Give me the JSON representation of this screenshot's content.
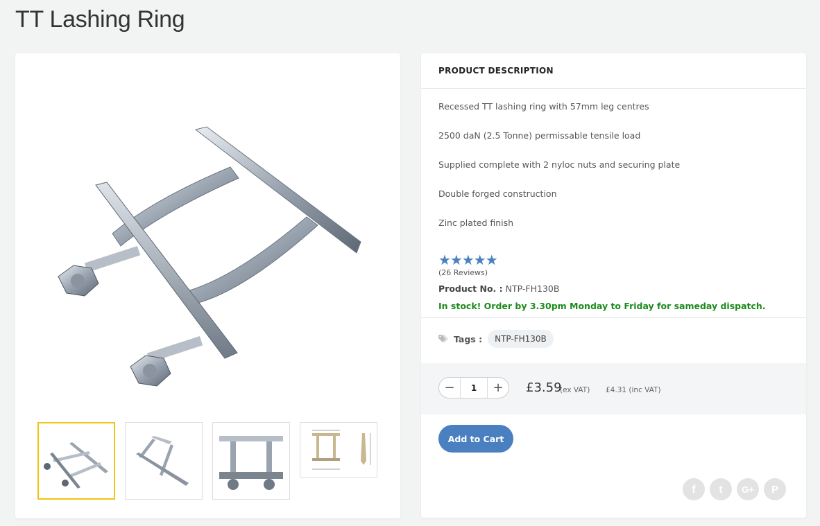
{
  "page": {
    "title": "TT Lashing Ring"
  },
  "description": {
    "header": "PRODUCT DESCRIPTION",
    "lines": [
      "Recessed TT lashing ring with 57mm leg centres",
      "2500 daN (2.5 Tonne) permissable tensile load",
      "Supplied complete with 2 nyloc nuts and securing plate",
      "Double forged construction",
      "Zinc plated finish"
    ]
  },
  "rating": {
    "stars": "★★★★★",
    "value": 5,
    "reviews": "(26 Reviews)"
  },
  "product": {
    "number_label": "Product No. :",
    "number": "NTP-FH130B",
    "stock": "In stock! Order by 3.30pm Monday to Friday for sameday dispatch."
  },
  "tags": {
    "label": "Tags :",
    "items": [
      "NTP-FH130B"
    ],
    "icon": "tag-icon"
  },
  "purchase": {
    "quantity": "1",
    "minus": "−",
    "plus": "+",
    "price": "£3.59",
    "ex_vat": "(ex VAT)",
    "inc_vat": "£4.31 (inc VAT)",
    "add_to_cart": "Add to Cart"
  },
  "social": [
    {
      "icon": "facebook-icon",
      "glyph": "f"
    },
    {
      "icon": "twitter-icon",
      "glyph": "t"
    },
    {
      "icon": "google-plus-icon",
      "glyph": "G+"
    },
    {
      "icon": "pinterest-icon",
      "glyph": "P"
    }
  ],
  "gallery": {
    "thumbnails": [
      "angle-view",
      "side-view",
      "top-view",
      "dimension-drawing"
    ],
    "active_index": 0
  },
  "colors": {
    "accent": "#4a80c0",
    "stock": "#1c8a1c",
    "active_thumb": "#f1c40f"
  }
}
